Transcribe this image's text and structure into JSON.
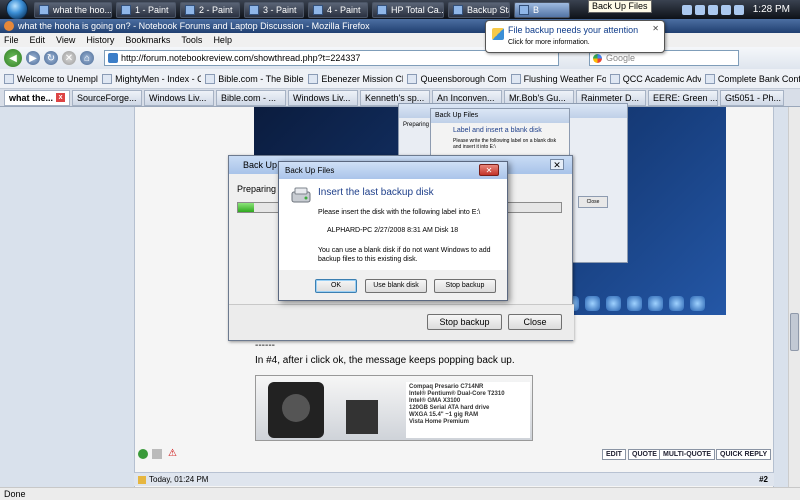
{
  "taskbar": {
    "tasks": [
      {
        "label": "what the hoo..."
      },
      {
        "label": "1 - Paint"
      },
      {
        "label": "2 - Paint"
      },
      {
        "label": "3 - Paint"
      },
      {
        "label": "4 - Paint"
      },
      {
        "label": "HP Total Ca..."
      },
      {
        "label": "Backup Stat..."
      },
      {
        "label": "B"
      }
    ],
    "tooltip": "Back Up Files",
    "clock": "1:28 PM"
  },
  "notification": {
    "title": "File backup needs your attention",
    "subtitle": "Click for more information."
  },
  "browser": {
    "title": "what the hooha is going on? - Notebook Forums and Laptop Discussion - Mozilla Firefox",
    "menu": [
      "File",
      "Edit",
      "View",
      "History",
      "Bookmarks",
      "Tools",
      "Help"
    ],
    "url": "http://forum.notebookreview.com/showthread.php?t=224337",
    "search_placeholder": "Google",
    "bookmarks": [
      "Welcome to Unemplo...",
      "MightyMen - Index - C...",
      "Bible.com - The Bible ...",
      "Ebenezer Mission Chur...",
      "Queensborough Comm...",
      "Flushing Weather Fore...",
      "QCC Academic Advise...",
      "Complete Bank Confir..."
    ],
    "tabs": [
      "what the...",
      "SourceForge...",
      "Windows Liv...",
      "Bible.com - ...",
      "Windows Liv...",
      "Kenneth's sp...",
      "An Inconven...",
      "Mr.Bob's Gu...",
      "Rainmeter D...",
      "EERE: Green ...",
      "Gt5051 - Ph..."
    ],
    "status": "Done"
  },
  "post": {
    "separator": "------",
    "text": "In #4, after i click ok, the message keeps popping back up.",
    "banner_specs": [
      "Compaq Presario C714NR",
      "Intel® Pentium® Dual-Core T2310",
      "Intel® GMA X3100",
      "120GB Serial ATA hard drive",
      "WXGA 15.4\"    ~1 gig RAM",
      "Vista Home Premium"
    ],
    "actions": [
      "EDIT",
      "QUOTE",
      "MULTI-QUOTE",
      "QUICK REPLY"
    ],
    "date": "Today, 01:24 PM",
    "number": "#2"
  },
  "ghost_dialog": {
    "title": "Back Up Files",
    "heading": "Label and insert a blank disk",
    "text": "Please write the following label on a blank disk and insert it into E:\\",
    "prep": "Preparing to",
    "close": "Close"
  },
  "backup_window": {
    "title": "Back Up Files",
    "preparing": "Preparing to",
    "progress": 0.05,
    "stop_label": "Stop backup",
    "close_label": "Close"
  },
  "dialog": {
    "title": "Back Up Files",
    "heading": "Insert the last backup disk",
    "message": "Please insert the disk with the following label into E:\\",
    "disk_label": "ALPHARD-PC 2/27/2008 8:31 AM Disk 18",
    "note": "You can use a blank disk if do not want Windows to add backup files to this existing disk.",
    "ok_label": "OK",
    "blank_label": "Use blank disk",
    "stop_label": "Stop backup"
  }
}
